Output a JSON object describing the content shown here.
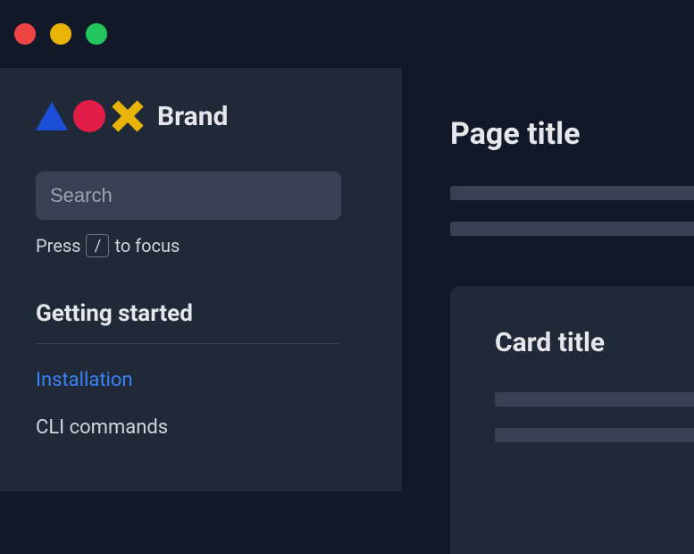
{
  "brand": {
    "name": "Brand"
  },
  "search": {
    "placeholder": "Search",
    "hint_pre": "Press",
    "hint_key": "/",
    "hint_post": "to focus"
  },
  "sidebar": {
    "section_title": "Getting started",
    "items": [
      {
        "label": "Installation",
        "active": true
      },
      {
        "label": "CLI commands",
        "active": false
      }
    ]
  },
  "main": {
    "page_title": "Page title",
    "card_title": "Card title"
  }
}
